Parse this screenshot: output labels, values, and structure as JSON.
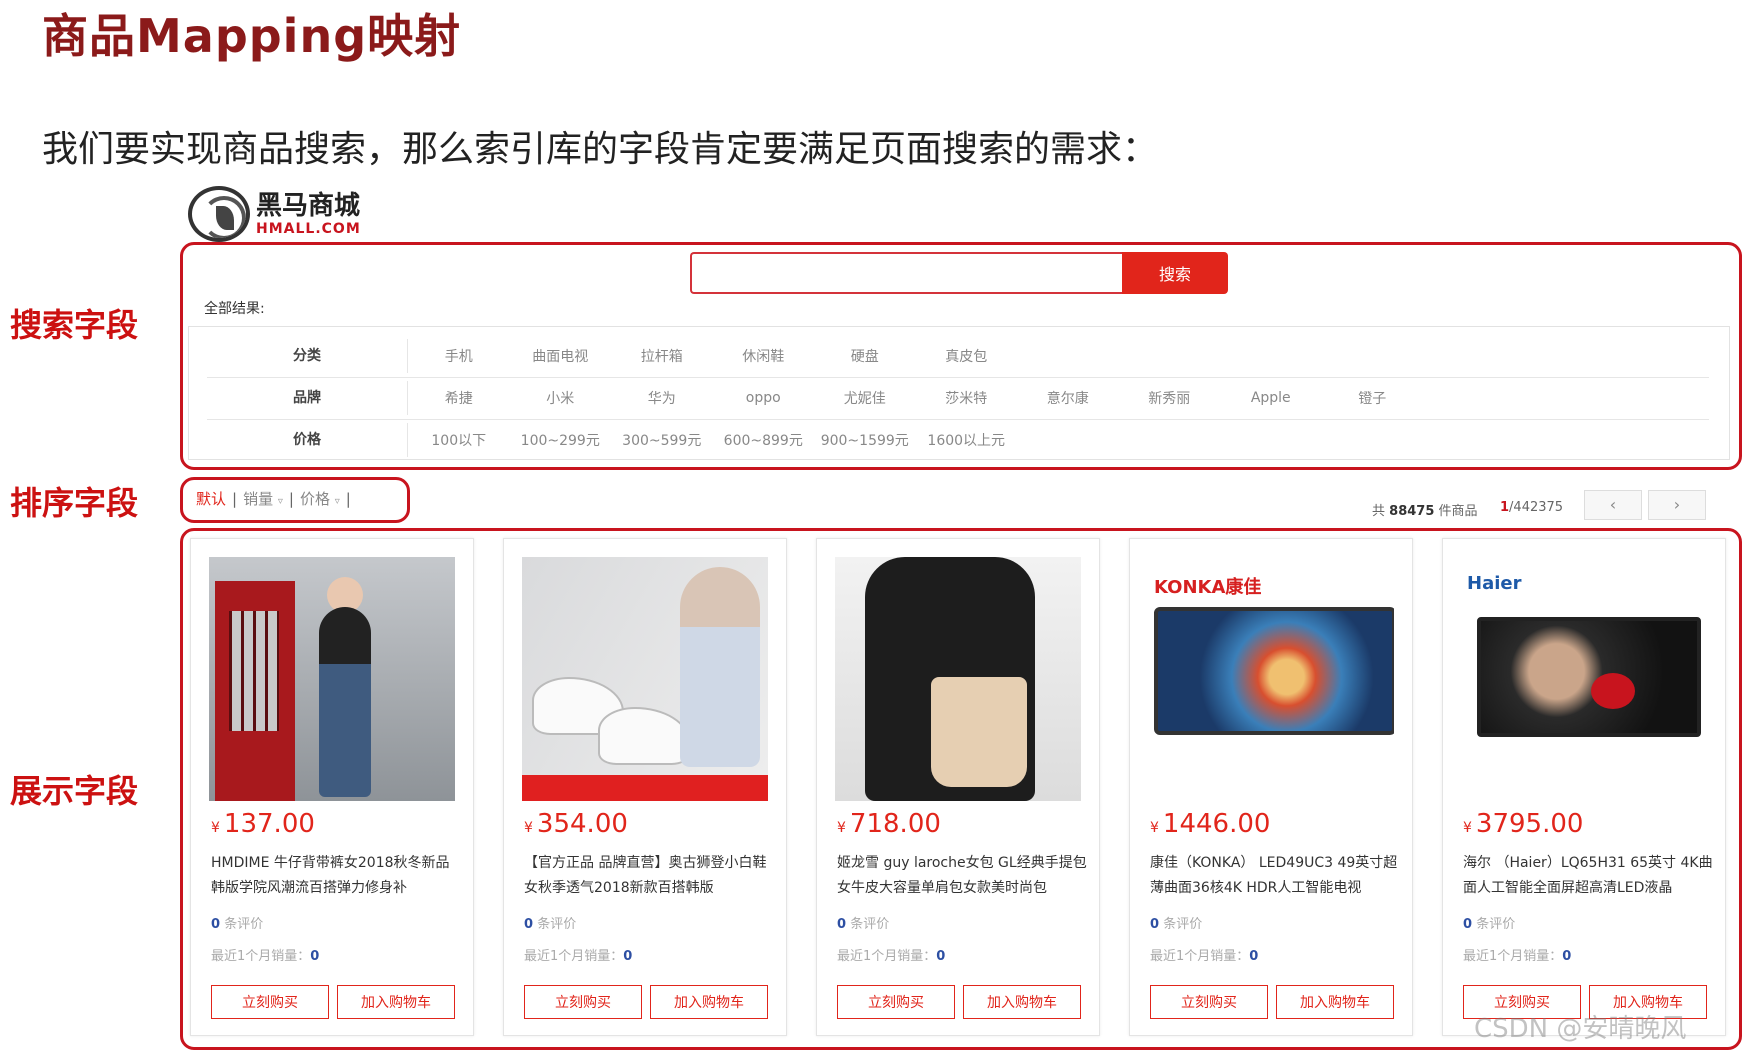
{
  "slide": {
    "title": "商品Mapping映射",
    "intro": "我们要实现商品搜索，那么索引库的字段肯定要满足页面搜索的需求：",
    "labels": {
      "search": "搜索字段",
      "sort": "排序字段",
      "display": "展示字段"
    }
  },
  "logo": {
    "name": "黑马商城",
    "domain": "HMALL.COM"
  },
  "search": {
    "button_label": "搜索",
    "input_value": "",
    "all_results": "全部结果:"
  },
  "filters": [
    {
      "label": "分类",
      "options": [
        "手机",
        "曲面电视",
        "拉杆箱",
        "休闲鞋",
        "硬盘",
        "真皮包"
      ]
    },
    {
      "label": "品牌",
      "options": [
        "希捷",
        "小米",
        "华为",
        "oppo",
        "尤妮佳",
        "莎米特",
        "意尔康",
        "新秀丽",
        "Apple",
        "镫子"
      ]
    },
    {
      "label": "价格",
      "options": [
        "100以下",
        "100~299元",
        "300~599元",
        "600~899元",
        "900~1599元",
        "1600以上元"
      ]
    }
  ],
  "sort": {
    "default": "默认",
    "sales": "销量",
    "price": "价格",
    "separator": "|",
    "caret": "▿"
  },
  "results": {
    "prefix": "共",
    "count": "88475",
    "suffix": "件商品",
    "current_page": "1",
    "total_pages": "/442375",
    "prev": "‹",
    "next": "›"
  },
  "products": [
    {
      "price": "137.00",
      "title": "HMDIME 牛仔背带裤女2018秋冬新品 韩版学院风潮流百搭弹力修身补",
      "reviews_count": "0",
      "reviews_label": "条评价",
      "sales_label": "最近1个月销量：",
      "sales_count": "0"
    },
    {
      "price": "354.00",
      "title": "【官方正品 品牌直营】奥古狮登小白鞋女秋季透气2018新款百搭韩版",
      "reviews_count": "0",
      "reviews_label": "条评价",
      "sales_label": "最近1个月销量：",
      "sales_count": "0"
    },
    {
      "price": "718.00",
      "title": "姬龙雪 guy laroche女包 GL经典手提包女牛皮大容量单肩包女款美时尚包",
      "reviews_count": "0",
      "reviews_label": "条评价",
      "sales_label": "最近1个月销量：",
      "sales_count": "0"
    },
    {
      "price": "1446.00",
      "title": "康佳（KONKA） LED49UC3 49英寸超薄曲面36核4K HDR人工智能电视",
      "reviews_count": "0",
      "reviews_label": "条评价",
      "sales_label": "最近1个月销量：",
      "sales_count": "0"
    },
    {
      "price": "3795.00",
      "title": "海尔 （Haier）LQ65H31 65英寸 4K曲面人工智能全面屏超高清LED液晶",
      "reviews_count": "0",
      "reviews_label": "条评价",
      "sales_label": "最近1个月销量：",
      "sales_count": "0"
    }
  ],
  "product_buttons": {
    "buy": "立刻购买",
    "cart": "加入购物车"
  },
  "product_image_text": {
    "konka_brand": "KONKA康佳",
    "haier_brand": "Haier"
  },
  "currency": "¥",
  "watermark": "CSDN @安晴晚风",
  "colors": {
    "accent": "#e1251b",
    "frame": "#c8141e",
    "title": "#8b1a1a",
    "link_blue": "#2d4fa3"
  }
}
